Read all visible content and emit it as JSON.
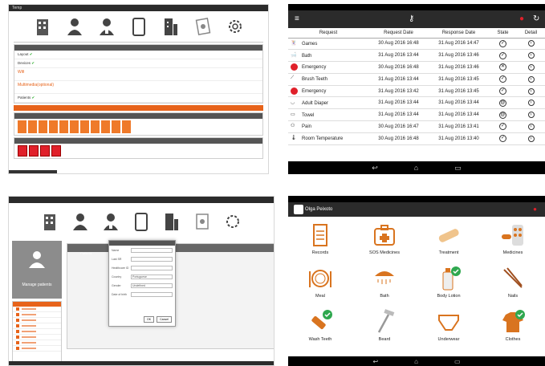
{
  "admin_web": {
    "brand": "Temp",
    "steps": [
      {
        "label": "Layout",
        "done": true
      },
      {
        "label": "Devices",
        "done": true
      },
      {
        "label": "Wifi",
        "done": false,
        "highlight": true
      },
      {
        "label": "Multimedia(optional)",
        "done": false,
        "highlight": true
      },
      {
        "label": "Patients",
        "done": true
      }
    ]
  },
  "requests_app": {
    "columns": [
      "Request",
      "Request Date",
      "Response Date",
      "State",
      "Detail"
    ],
    "rows": [
      {
        "request": "Games",
        "request_date": "30 Aug 2016 16:48",
        "response_date": "31 Aug 2016 14:47",
        "state": "done",
        "icon": "games-icon"
      },
      {
        "request": "Bath",
        "request_date": "31 Aug 2016 13:44",
        "response_date": "31 Aug 2016 13:46",
        "state": "done",
        "icon": "bath-icon"
      },
      {
        "request": "Emergency",
        "request_date": "30 Aug 2016 16:48",
        "response_date": "31 Aug 2016 13:46",
        "state": "rejected",
        "icon": "emergency-icon"
      },
      {
        "request": "Brush Teeth",
        "request_date": "31 Aug 2016 13:44",
        "response_date": "31 Aug 2016 13:45",
        "state": "done",
        "icon": "toothbrush-icon"
      },
      {
        "request": "Emergency",
        "request_date": "31 Aug 2016 13:42",
        "response_date": "31 Aug 2016 13:45",
        "state": "done",
        "icon": "emergency-icon"
      },
      {
        "request": "Adult Diaper",
        "request_date": "31 Aug 2016 13:44",
        "response_date": "31 Aug 2016 13:44",
        "state": "pending",
        "icon": "diaper-icon"
      },
      {
        "request": "Towel",
        "request_date": "31 Aug 2016 13:44",
        "response_date": "31 Aug 2016 13:44",
        "state": "pending",
        "icon": "towel-icon"
      },
      {
        "request": "Pain",
        "request_date": "30 Aug 2016 16:47",
        "response_date": "31 Aug 2016 13:41",
        "state": "done",
        "icon": "pain-icon"
      },
      {
        "request": "Room Temperature",
        "request_date": "30 Aug 2016 16:48",
        "response_date": "31 Aug 2016 13:40",
        "state": "done",
        "icon": "thermometer-icon"
      }
    ]
  },
  "patients_web": {
    "manage_label": "Manage patients",
    "panel_title": "Patients",
    "modal": {
      "fields": [
        "Name",
        "Last SR",
        "Healthcare ID",
        "Country",
        "Gender",
        "Date of birth"
      ],
      "values": [
        "",
        "",
        "",
        "Portuguese",
        "Undefined",
        ""
      ],
      "ok": "OK",
      "cancel": "Cancel"
    }
  },
  "patient_app": {
    "patient_name": "Olga Peixoto",
    "tiles": [
      {
        "label": "Records",
        "icon": "records-icon"
      },
      {
        "label": "SOS Medicines",
        "icon": "first-aid-icon"
      },
      {
        "label": "Treatment",
        "icon": "bandage-icon"
      },
      {
        "label": "Medicines",
        "icon": "pills-icon"
      },
      {
        "label": "Meal",
        "icon": "plate-icon"
      },
      {
        "label": "Bath",
        "icon": "shower-icon"
      },
      {
        "label": "Body Lotion",
        "icon": "lotion-icon"
      },
      {
        "label": "Nails",
        "icon": "nail-clipper-icon"
      },
      {
        "label": "Wash Teeth",
        "icon": "toothpaste-icon"
      },
      {
        "label": "Beard",
        "icon": "razor-icon"
      },
      {
        "label": "Underwear",
        "icon": "underwear-icon"
      },
      {
        "label": "Clothes",
        "icon": "clothes-icon"
      }
    ]
  },
  "colors": {
    "accent": "#e7631a",
    "dark_bar": "#2b2b2b",
    "alert_red": "#e0202a",
    "check_green": "#2fa84f"
  }
}
